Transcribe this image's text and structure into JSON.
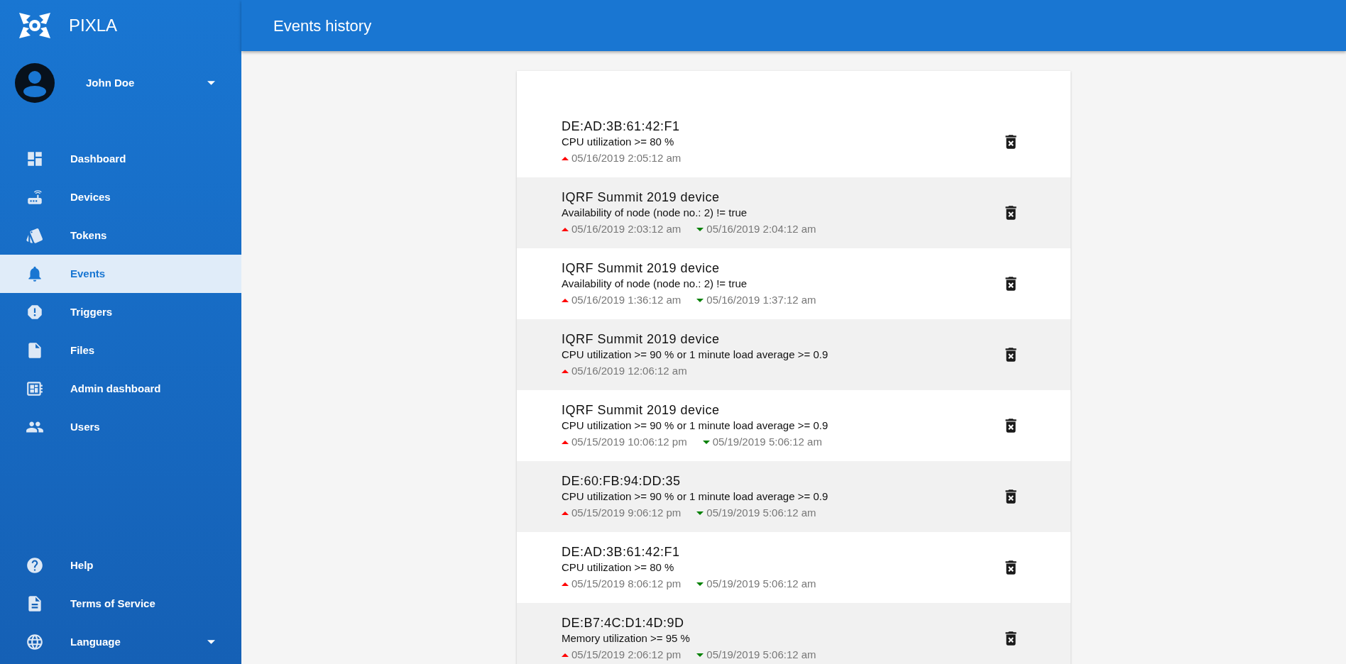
{
  "brand": {
    "name": "PIXLA"
  },
  "user": {
    "name": "John Doe"
  },
  "nav": [
    {
      "label": "Dashboard",
      "selected": false
    },
    {
      "label": "Devices",
      "selected": false
    },
    {
      "label": "Tokens",
      "selected": false
    },
    {
      "label": "Events",
      "selected": true
    },
    {
      "label": "Triggers",
      "selected": false
    },
    {
      "label": "Files",
      "selected": false
    },
    {
      "label": "Admin dashboard",
      "selected": false
    },
    {
      "label": "Users",
      "selected": false
    }
  ],
  "nav_bottom": [
    {
      "label": "Help",
      "kind": "link"
    },
    {
      "label": "Terms of Service",
      "kind": "link"
    },
    {
      "label": "Language",
      "kind": "dropdown"
    }
  ],
  "header": {
    "title": "Events history"
  },
  "events": [
    {
      "device": "DE:AD:3B:61:42:F1",
      "condition": "CPU utilization >= 80 %",
      "times": [
        {
          "kind": "raised",
          "text": "05/16/2019 2:05:12 am"
        }
      ]
    },
    {
      "device": "IQRF Summit 2019 device",
      "condition": "Availability of node (node no.: 2) != true",
      "times": [
        {
          "kind": "raised",
          "text": "05/16/2019 2:03:12 am"
        },
        {
          "kind": "cleared",
          "text": "05/16/2019 2:04:12 am"
        }
      ]
    },
    {
      "device": "IQRF Summit 2019 device",
      "condition": "Availability of node (node no.: 2) != true",
      "times": [
        {
          "kind": "raised",
          "text": "05/16/2019 1:36:12 am"
        },
        {
          "kind": "cleared",
          "text": "05/16/2019 1:37:12 am"
        }
      ]
    },
    {
      "device": "IQRF Summit 2019 device",
      "condition": "CPU utilization >= 90 % or 1 minute load average >= 0.9",
      "times": [
        {
          "kind": "raised",
          "text": "05/16/2019 12:06:12 am"
        }
      ]
    },
    {
      "device": "IQRF Summit 2019 device",
      "condition": "CPU utilization >= 90 % or 1 minute load average >= 0.9",
      "times": [
        {
          "kind": "raised",
          "text": "05/15/2019 10:06:12 pm"
        },
        {
          "kind": "cleared",
          "text": "05/19/2019 5:06:12 am"
        }
      ]
    },
    {
      "device": "DE:60:FB:94:DD:35",
      "condition": "CPU utilization >= 90 % or 1 minute load average >= 0.9",
      "times": [
        {
          "kind": "raised",
          "text": "05/15/2019 9:06:12 pm"
        },
        {
          "kind": "cleared",
          "text": "05/19/2019 5:06:12 am"
        }
      ]
    },
    {
      "device": "DE:AD:3B:61:42:F1",
      "condition": "CPU utilization >= 80 %",
      "times": [
        {
          "kind": "raised",
          "text": "05/15/2019 8:06:12 pm"
        },
        {
          "kind": "cleared",
          "text": "05/19/2019 5:06:12 am"
        }
      ]
    },
    {
      "device": "DE:B7:4C:D1:4D:9D",
      "condition": "Memory utilization >= 95 %",
      "times": [
        {
          "kind": "raised",
          "text": "05/15/2019 2:06:12 pm"
        },
        {
          "kind": "cleared",
          "text": "05/19/2019 5:06:12 am"
        }
      ]
    }
  ]
}
